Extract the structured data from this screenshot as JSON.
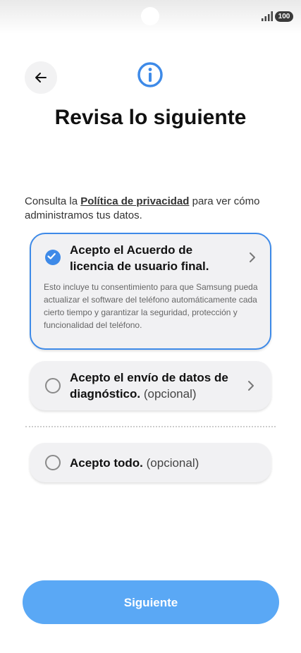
{
  "status_bar": {
    "battery": "100",
    "signal_icon": "signal-bars-icon"
  },
  "header": {
    "back_icon": "arrow-left-icon",
    "info_icon": "info-circle-icon",
    "title": "Revisa lo siguiente"
  },
  "privacy": {
    "prefix": "Consulta la ",
    "link": "Política de privacidad",
    "suffix": " para ver cómo administramos tus datos."
  },
  "options": [
    {
      "label": "Acepto el Acuerdo de licencia de usuario final.",
      "optional": "",
      "checked": true,
      "description": "Esto incluye tu consentimiento para que Samsung pueda actualizar el software del teléfono automáticamente cada cierto tiempo y garantizar la seguridad, protección y funcionalidad del teléfono."
    },
    {
      "label": "Acepto el envío de datos de diagnóstico.",
      "optional": "(opcional)",
      "checked": false
    },
    {
      "label": "Acepto todo.",
      "optional": "(opcional)",
      "checked": false
    }
  ],
  "footer": {
    "next_label": "Siguiente"
  },
  "colors": {
    "accent": "#3e8ae8",
    "button": "#5aa8f5",
    "card": "#f1f1f3"
  }
}
